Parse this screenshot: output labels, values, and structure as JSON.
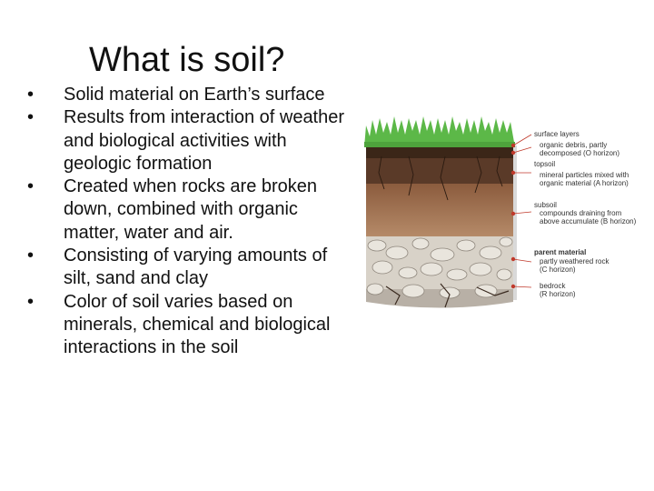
{
  "slide": {
    "title": "What is soil?",
    "bullet_glyph": "•",
    "bullets": [
      "Solid material on Earth’s surface",
      "Results from interaction of weather and biological activities with geologic formation",
      "Created when rocks are broken down, combined with organic matter, water and air.",
      "Consisting of varying amounts of silt, sand and clay",
      "Color of soil varies based on minerals, chemical and biological interactions in the soil"
    ]
  },
  "diagram": {
    "labels": {
      "surface_layers": "surface layers",
      "organic_debris_1": "organic debris, partly",
      "organic_debris_2": "decomposed (O horizon)",
      "topsoil": "topsoil",
      "mineral_1": "mineral particles mixed with",
      "mineral_2": "organic material (A horizon)",
      "subsoil": "subsoil",
      "compounds_1": "compounds draining from",
      "compounds_2": "above accumulate (B horizon)",
      "parent_material": "parent material",
      "weathered_1": "partly weathered rock",
      "weathered_2": "(C horizon)",
      "bedrock_1": "bedrock",
      "bedrock_2": "(R horizon)"
    },
    "colors": {
      "grass": "#5cb848",
      "o_horizon": "#3b2618",
      "a_horizon": "#5a3a28",
      "b_horizon_top": "#8a5a3c",
      "b_horizon_bottom": "#b58a68",
      "c_horizon": "#d8d2c8",
      "r_horizon": "#b8b0a6",
      "leader_line": "#c0392b"
    }
  }
}
